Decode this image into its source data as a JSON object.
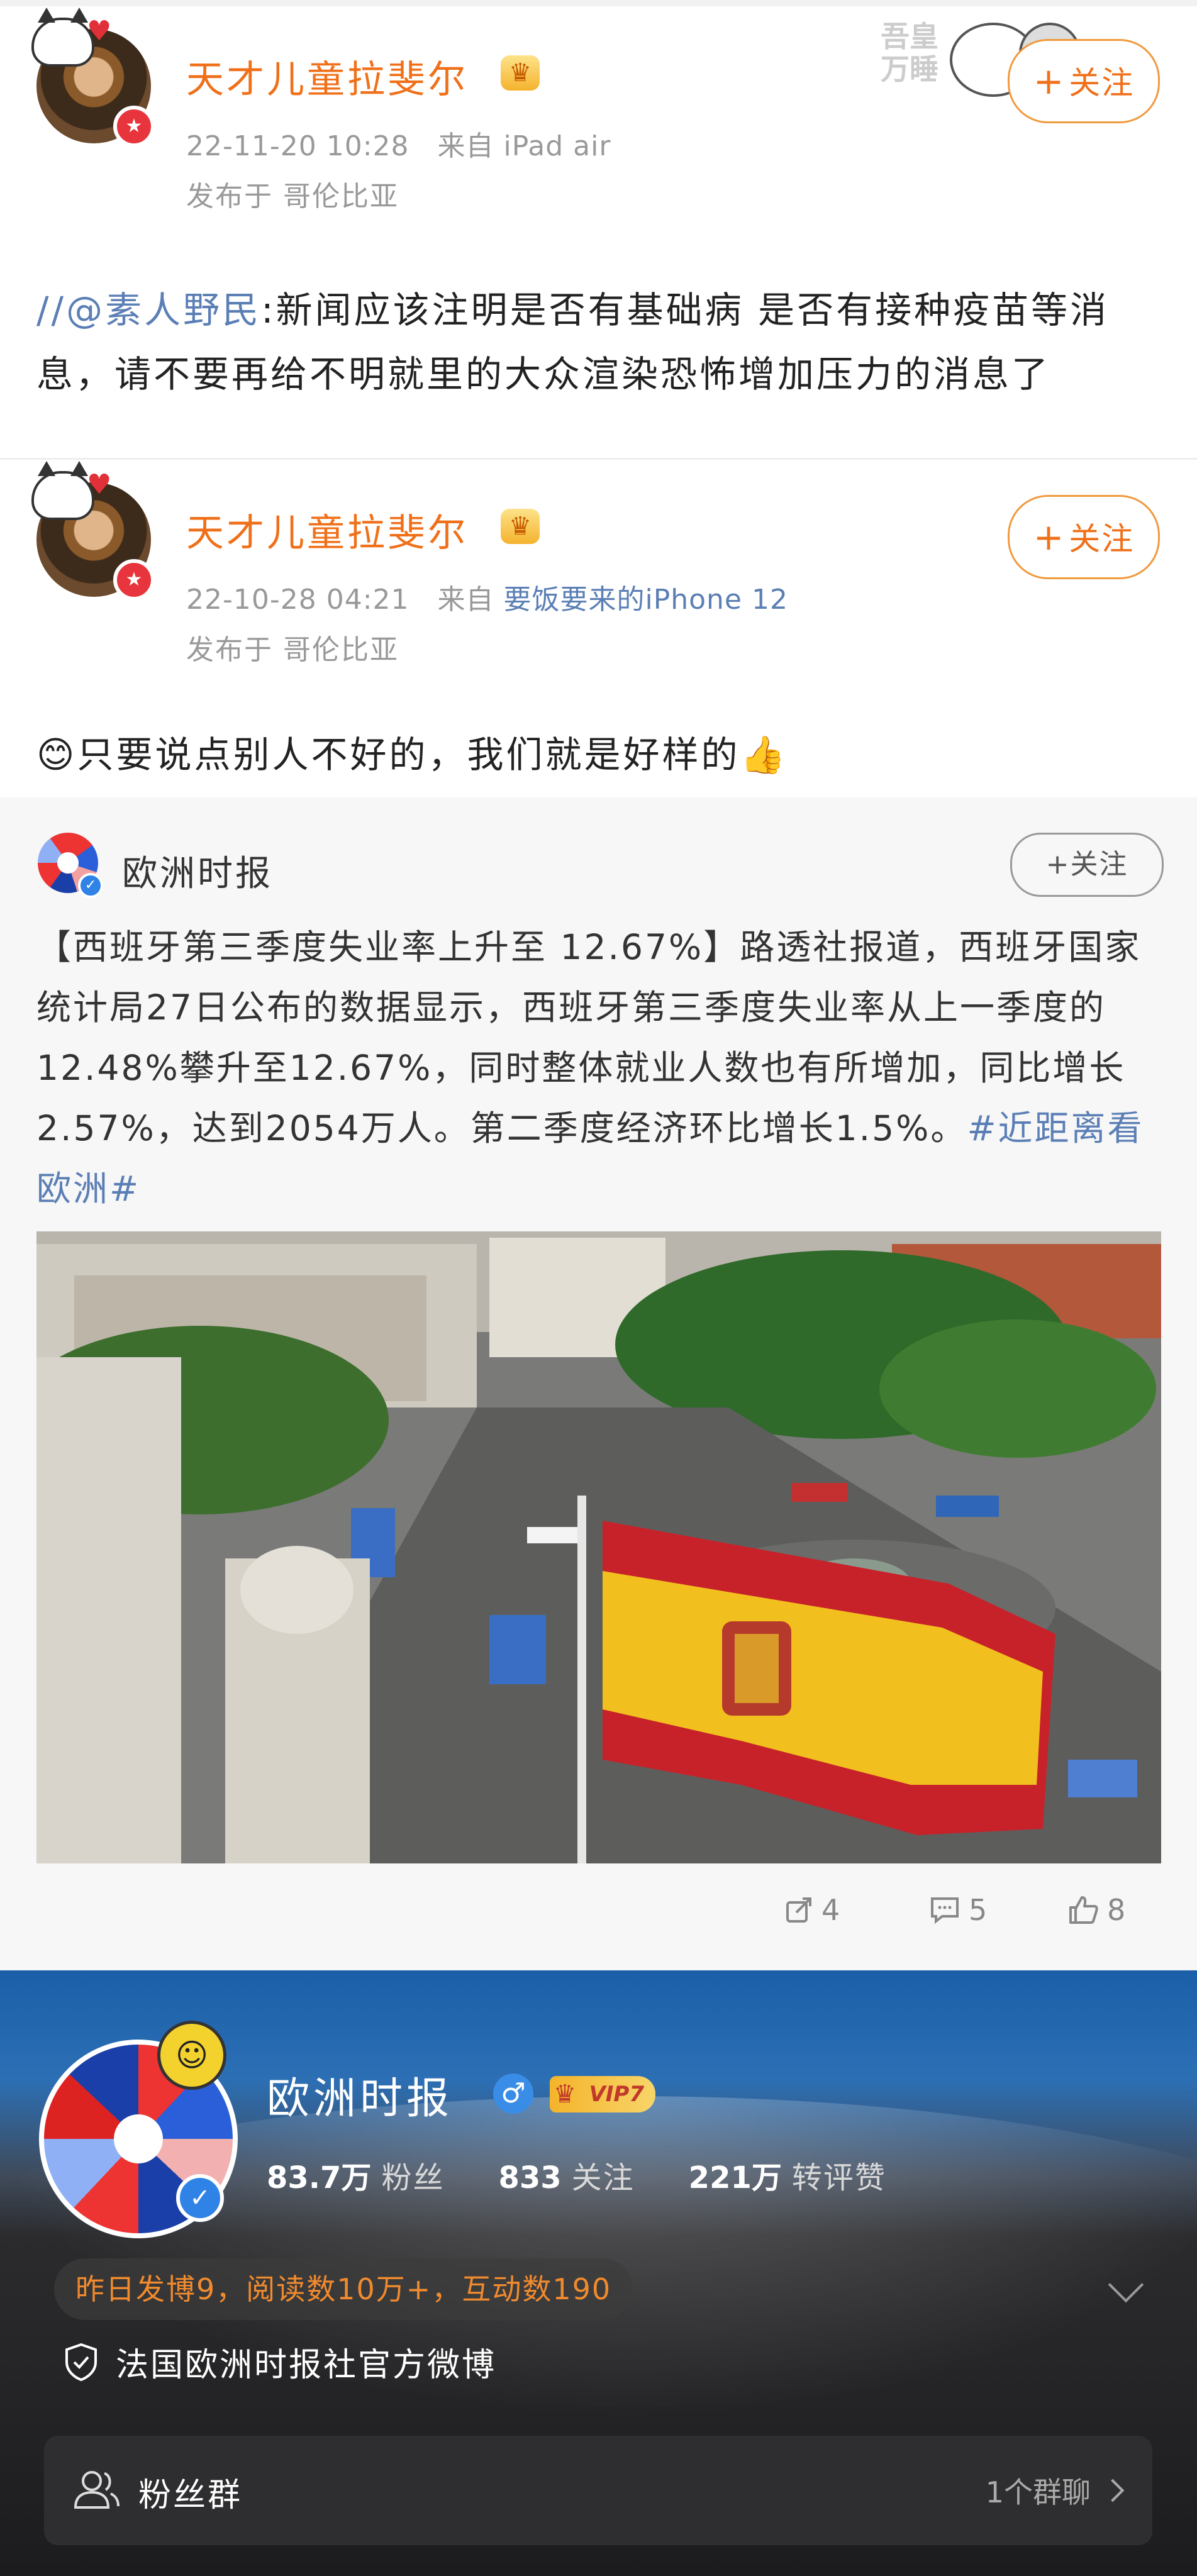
{
  "post1": {
    "username": "天才儿童拉斐尔",
    "time": "22-11-20 10:28",
    "source_prefix": "来自",
    "source": "iPad air",
    "location": "发布于 哥伦比亚",
    "follow": "关注",
    "text_mention": "//@素人野民",
    "text_body": ":新闻应该注明是否有基础病 是否有接种疫苗等消息，请不要再给不明就里的大众渲染恐怖增加压力的消息了"
  },
  "post2": {
    "username": "天才儿童拉斐尔",
    "time": "22-10-28 04:21",
    "source_prefix": "来自",
    "source": "要饭要来的iPhone 12",
    "location": "发布于 哥伦比亚",
    "follow": "关注",
    "text_emoji": "😊",
    "text_body": "只要说点别人不好的，我们就是好样的",
    "text_emoji_end": "👍"
  },
  "repost": {
    "name": "欧洲时报",
    "follow": "关注",
    "text": "【西班牙第三季度失业率上升至 12.67%】路透社报道，西班牙国家统计局27日公布的数据显示，西班牙第三季度失业率从上一季度的12.48%攀升至12.67%，同时整体就业人数也有所增加，同比增长2.57%，达到2054万人。第二季度经济环比增长1.5%。",
    "hashtag": "#近距离看欧洲#",
    "shares": "4",
    "comments": "5",
    "likes": "8"
  },
  "profile": {
    "name": "欧洲时报",
    "vip": "VIP7",
    "fans_value": "83.7万",
    "fans_label": "粉丝",
    "following_value": "833",
    "following_label": "关注",
    "interactions_value": "221万",
    "interactions_label": "转评赞",
    "activity": "昨日发博9，阅读数10万+，互动数190",
    "verified": "法国欧洲时报社官方微博",
    "fan_group_label": "粉丝群",
    "fan_group_count": "1个群聊"
  },
  "colors": {
    "username_orange": "#f0701a",
    "link_blue": "#5b7fb5",
    "activity_orange": "#f08a2e",
    "verified_blue": "#2f83e6"
  }
}
